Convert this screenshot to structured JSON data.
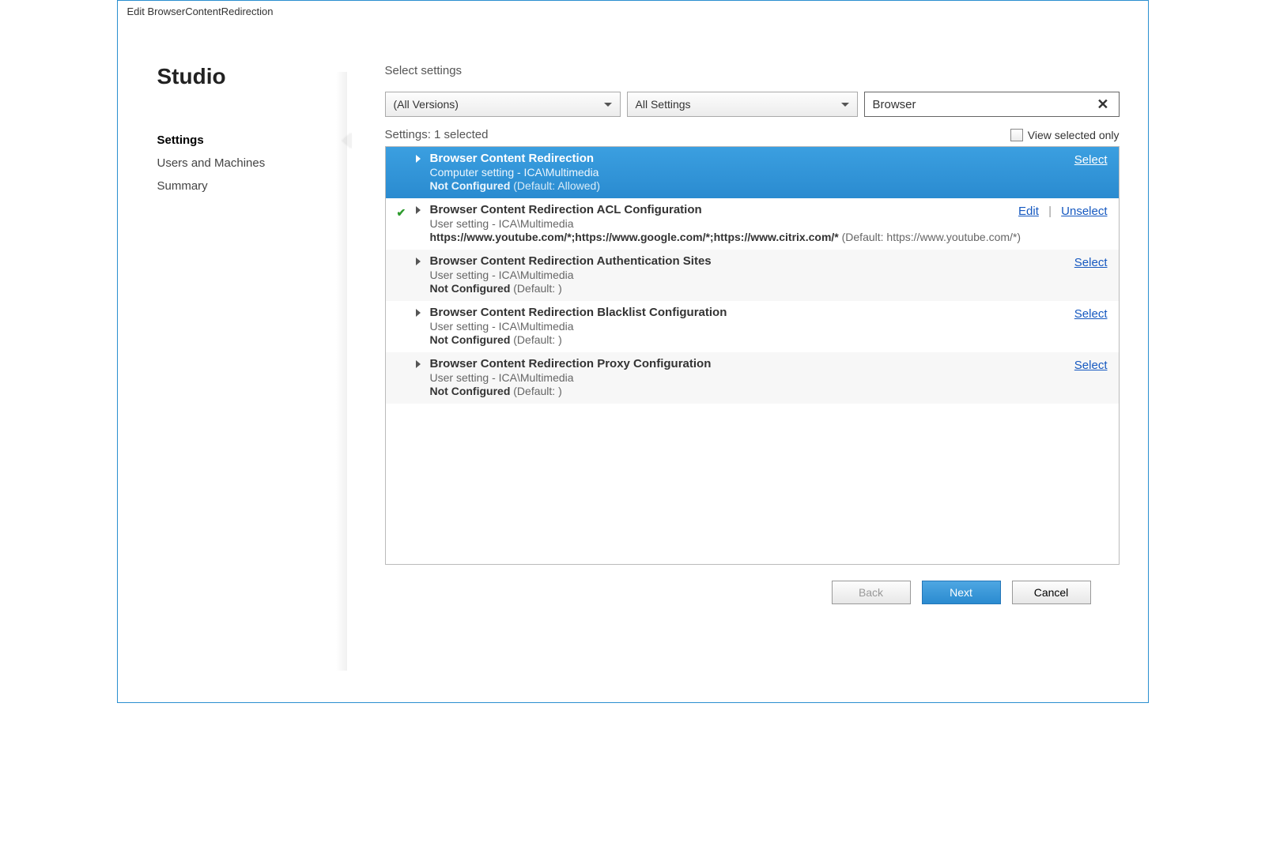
{
  "window": {
    "title": "Edit BrowserContentRedirection"
  },
  "sidebar": {
    "brand": "Studio",
    "items": [
      {
        "label": "Settings",
        "selected": true
      },
      {
        "label": "Users and Machines",
        "selected": false
      },
      {
        "label": "Summary",
        "selected": false
      }
    ]
  },
  "main": {
    "heading": "Select settings",
    "versionFilter": "(All Versions)",
    "categoryFilter": "All Settings",
    "searchValue": "Browser",
    "settingsPrefix": "Settings:",
    "settingsCount": "1 selected",
    "viewSelectedLabel": "View selected only"
  },
  "actions": {
    "select": "Select",
    "edit": "Edit",
    "unselect": "Unselect"
  },
  "items": [
    {
      "title": "Browser Content Redirection",
      "scope": "Computer setting - ICA\\Multimedia",
      "statusLabel": "Not Configured",
      "defaultText": "(Default: Allowed)",
      "selectedRow": true,
      "checked": false,
      "action": "select"
    },
    {
      "title": "Browser Content Redirection ACL Configuration",
      "scope": "User setting - ICA\\Multimedia",
      "valueLine": "https://www.youtube.com/*;https://www.google.com/*;https://www.citrix.com/*",
      "defaultText": "(Default: https://www.youtube.com/*)",
      "selectedRow": false,
      "checked": true,
      "action": "edit-unselect"
    },
    {
      "title": "Browser Content Redirection Authentication Sites",
      "scope": "User setting - ICA\\Multimedia",
      "statusLabel": "Not Configured",
      "defaultText": "(Default: )",
      "selectedRow": false,
      "checked": false,
      "action": "select",
      "alt": true
    },
    {
      "title": "Browser Content Redirection Blacklist Configuration",
      "scope": "User setting - ICA\\Multimedia",
      "statusLabel": "Not Configured",
      "defaultText": "(Default: )",
      "selectedRow": false,
      "checked": false,
      "action": "select"
    },
    {
      "title": "Browser Content Redirection Proxy Configuration",
      "scope": "User setting - ICA\\Multimedia",
      "statusLabel": "Not Configured",
      "defaultText": "(Default: )",
      "selectedRow": false,
      "checked": false,
      "action": "select",
      "alt": true
    }
  ],
  "footer": {
    "back": "Back",
    "next": "Next",
    "cancel": "Cancel"
  }
}
